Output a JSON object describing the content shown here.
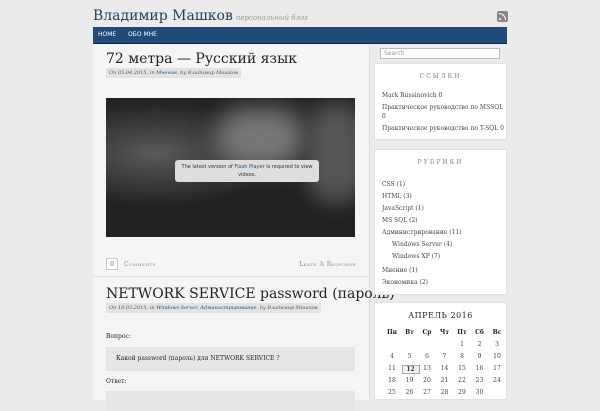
{
  "header": {
    "blog_title": "Владимир Машков",
    "tagline": "персональный блог"
  },
  "nav": {
    "items": [
      "HOME",
      "ОБО МНЕ"
    ]
  },
  "post1": {
    "title": "72 метра — Русский язык",
    "meta_prefix": "On 05.04.2015, in",
    "meta_category": "Мнение",
    "meta_author": ", by Владимир Машков",
    "video_notice_1": "The latest version of",
    "video_notice_link": "Flash Player",
    "video_notice_2": "is required to view videos.",
    "comment_count": "0",
    "comments_label": "Comments",
    "leave_response_label": "Leave A Response"
  },
  "post2": {
    "title": "NETWORK SERVICE password (пароль)",
    "meta_prefix": "On 18.03.2015, in",
    "meta_categories": "Windows Server, Администрирование",
    "meta_author": ", by Владимир Машков",
    "question_label": "Вопрос:",
    "question_text": "Какой password (пароль) для NETWORK SERVICE ?",
    "answer_label": "Ответ:"
  },
  "sidebar": {
    "search_placeholder": "Search",
    "links_title": "ССЫЛКИ",
    "links": [
      "Mark Russinovich 0",
      "Практическое руководство по MSSQL",
      "0",
      "Практическое руководство по T-SQL 0"
    ],
    "rubrics_title": "РУБРИКИ",
    "rubrics": [
      "CSS (1)",
      "HTML (3)",
      "JavaScript (1)",
      "MS SQL (2)",
      "Администрирование (11)",
      "Windows Server (4)",
      "Windows XP (7)",
      "Мнение (1)",
      "Экономика (2)"
    ],
    "calendar": {
      "title": "АПРЕЛЬ 2016",
      "weekdays": [
        "Пн",
        "Вт",
        "Ср",
        "Чт",
        "Пт",
        "Сб",
        "Вс"
      ],
      "rows": [
        [
          "",
          "",
          "",
          "",
          "1",
          "2",
          "3"
        ],
        [
          "4",
          "5",
          "6",
          "7",
          "8",
          "9",
          "10"
        ],
        [
          "11",
          "12",
          "13",
          "14",
          "15",
          "16",
          "17"
        ],
        [
          "18",
          "19",
          "20",
          "21",
          "22",
          "23",
          "24"
        ],
        [
          "25",
          "26",
          "27",
          "28",
          "29",
          "30",
          ""
        ]
      ],
      "today": "12"
    }
  },
  "colors": {
    "nav_bg": "#1f4a7a",
    "title": "#1d3e5e",
    "link": "#1f4a7a"
  }
}
